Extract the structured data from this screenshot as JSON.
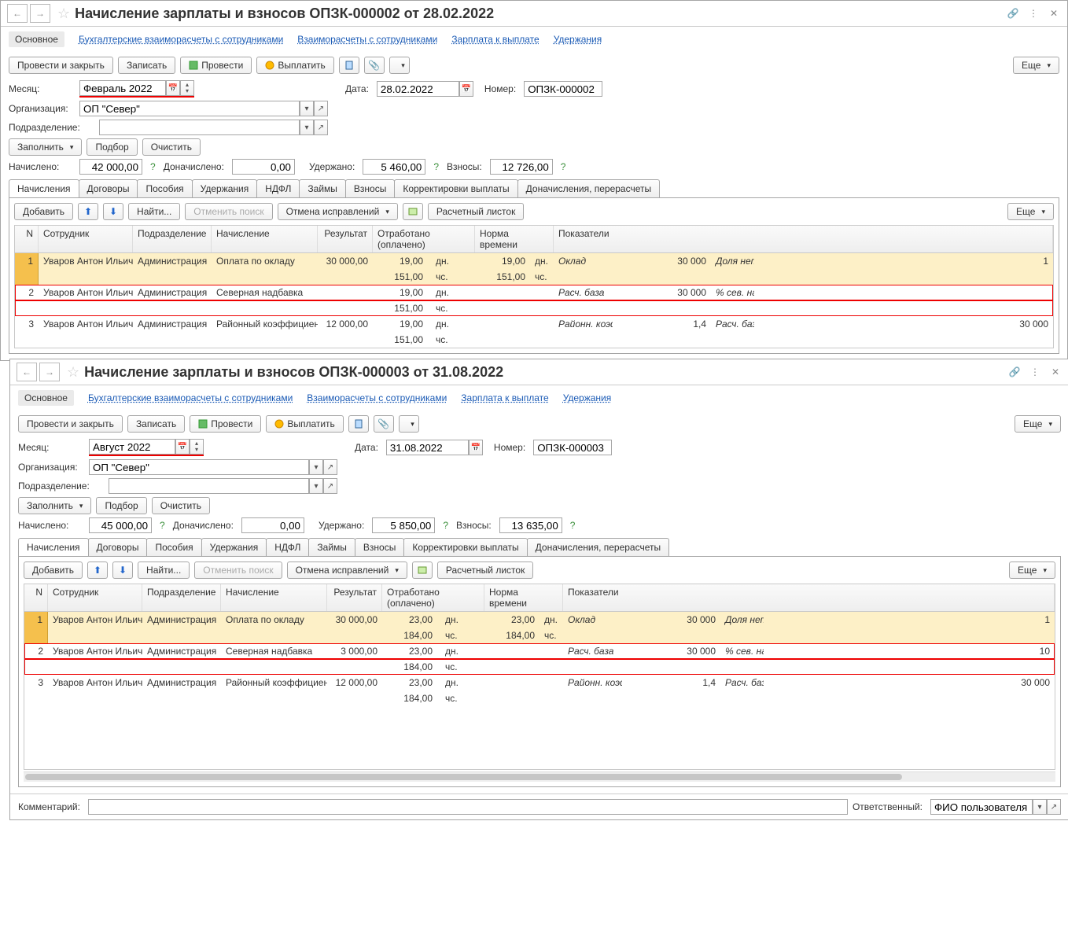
{
  "common": {
    "nav_main": "Основное",
    "nav_buh": "Бухгалтерские взаиморасчеты с сотрудниками",
    "nav_vzaim": "Взаиморасчеты с сотрудниками",
    "nav_zp": "Зарплата к выплате",
    "nav_ud": "Удержания",
    "btn_provesti_close": "Провести и закрыть",
    "btn_save": "Записать",
    "btn_provesti": "Провести",
    "btn_pay": "Выплатить",
    "btn_more": "Еще",
    "lbl_month": "Месяц:",
    "lbl_date": "Дата:",
    "lbl_number": "Номер:",
    "lbl_org": "Организация:",
    "lbl_dept": "Подразделение:",
    "btn_fill": "Заполнить",
    "btn_pick": "Подбор",
    "btn_clear": "Очистить",
    "lbl_accrued": "Начислено:",
    "lbl_added": "Доначислено:",
    "lbl_deducted": "Удержано:",
    "lbl_contrib": "Взносы:",
    "org_value": "ОП \"Север\"",
    "tabs": [
      "Начисления",
      "Договоры",
      "Пособия",
      "Удержания",
      "НДФЛ",
      "Займы",
      "Взносы",
      "Корректировки выплаты",
      "Доначисления, перерасчеты"
    ],
    "btn_add": "Добавить",
    "btn_find": "Найти...",
    "btn_cancel_search": "Отменить поиск",
    "btn_cancel_fix": "Отмена исправлений",
    "btn_payslip": "Расчетный листок",
    "th_n": "N",
    "th_emp": "Сотрудник",
    "th_dept": "Подразделение",
    "th_accrual": "Начисление",
    "th_result": "Результат",
    "th_worked": "Отработано (оплачено)",
    "th_norm": "Норма времени",
    "th_ind": "Показатели",
    "lbl_comment": "Комментарий:",
    "lbl_resp": "Ответственный:",
    "resp_value": "ФИО пользователя",
    "employee": "Уваров Антон Ильич",
    "dept": "Администрация",
    "acc_salary": "Оплата по окладу",
    "acc_north": "Северная надбавка",
    "acc_region": "Районный коэффициент",
    "u_days": "дн.",
    "u_hours": "чс.",
    "ind_oklad": "Оклад",
    "ind_share": "Доля неполн....",
    "ind_base": "Расч. база",
    "ind_pct": "% сев. надб.",
    "ind_koef": "Районн. коэфф.",
    "ind_rbase": "Расч. база"
  },
  "w1": {
    "title": "Начисление зарплаты и взносов ОПЗК-000002 от 28.02.2022",
    "month": "Февраль 2022",
    "date": "28.02.2022",
    "number": "ОПЗК-000002",
    "accrued": "42 000,00",
    "added": "0,00",
    "deducted": "5 460,00",
    "contrib": "12 726,00",
    "rows": [
      {
        "n": "1",
        "result": "30 000,00",
        "wd": "19,00",
        "wh": "151,00",
        "nd": "19,00",
        "nh": "151,00",
        "ind1_val": "30 000",
        "ind2_val": "1"
      },
      {
        "n": "2",
        "result": "",
        "wd": "19,00",
        "wh": "151,00",
        "nd": "",
        "nh": "",
        "ind1_val": "30 000",
        "ind2_val": ""
      },
      {
        "n": "3",
        "result": "12 000,00",
        "wd": "19,00",
        "wh": "151,00",
        "nd": "",
        "nh": "",
        "ind1_val": "1,4",
        "ind2_val": "30 000"
      }
    ]
  },
  "w2": {
    "title": "Начисление зарплаты и взносов ОПЗК-000003 от 31.08.2022",
    "month": "Август 2022",
    "date": "31.08.2022",
    "number": "ОПЗК-000003",
    "accrued": "45 000,00",
    "added": "0,00",
    "deducted": "5 850,00",
    "contrib": "13 635,00",
    "rows": [
      {
        "n": "1",
        "result": "30 000,00",
        "wd": "23,00",
        "wh": "184,00",
        "nd": "23,00",
        "nh": "184,00",
        "ind1_val": "30 000",
        "ind2_val": "1"
      },
      {
        "n": "2",
        "result": "3 000,00",
        "wd": "23,00",
        "wh": "184,00",
        "nd": "",
        "nh": "",
        "ind1_val": "30 000",
        "ind2_val": "10"
      },
      {
        "n": "3",
        "result": "12 000,00",
        "wd": "23,00",
        "wh": "184,00",
        "nd": "",
        "nh": "",
        "ind1_val": "1,4",
        "ind2_val": "30 000"
      }
    ]
  }
}
